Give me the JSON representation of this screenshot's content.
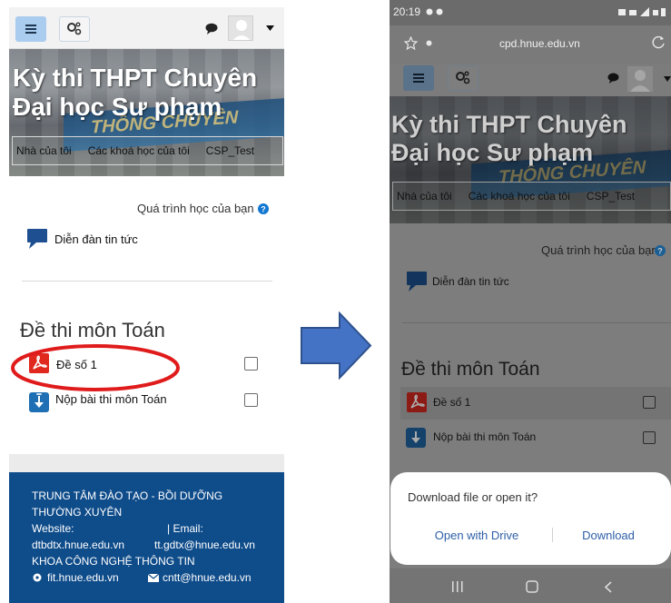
{
  "left": {
    "hero_title": "Kỳ thi THPT Chuyên Đại học Sư phạm",
    "breadcrumbs": [
      "Nhà của tôi",
      "Các khoá học của tôi",
      "CSP_Test"
    ],
    "progress_label": "Quá trình học của bạn",
    "forum_label": "Diễn đàn tin tức",
    "section_title": "Đề thi môn Toán",
    "activities": [
      {
        "label": "Đề số 1"
      },
      {
        "label": "Nộp bài thi môn Toán"
      }
    ],
    "footer": {
      "center_line1": "TRUNG TÂM ĐÀO TẠO - BỒI DƯỠNG",
      "center_line2": "THƯỜNG XUYÊN",
      "website_label": "Website:",
      "email_label": "| Email:",
      "website": "dtbdtx.hnue.edu.vn",
      "email": "tt.gdtx@hnue.edu.vn",
      "faculty": "KHOA CÔNG NGHỆ THÔNG TIN",
      "faculty_site": "fit.hnue.edu.vn",
      "faculty_email": "cntt@hnue.edu.vn"
    }
  },
  "right": {
    "status_time": "20:19",
    "url": "cpd.hnue.edu.vn",
    "hero_title": "Kỳ thi THPT Chuyên Đại học Sư phạm",
    "breadcrumbs": [
      "Nhà của tôi",
      "Các khoá học của tôi",
      "CSP_Test"
    ],
    "progress_label": "Quá trình học của bạn",
    "forum_label": "Diễn đàn tin tức",
    "section_title": "Đề thi môn Toán",
    "activities": [
      {
        "label": "Đề số 1"
      },
      {
        "label": "Nộp bài thi môn Toán"
      }
    ],
    "dialog": {
      "question": "Download file or open it?",
      "open_label": "Open with Drive",
      "download_label": "Download"
    }
  },
  "colors": {
    "accent": "#1177d1",
    "footer_bg": "#0f4c8a",
    "highlight_circle": "#e01b1b",
    "arrow": "#4472c4",
    "dialog_button": "#2e5fa7"
  }
}
